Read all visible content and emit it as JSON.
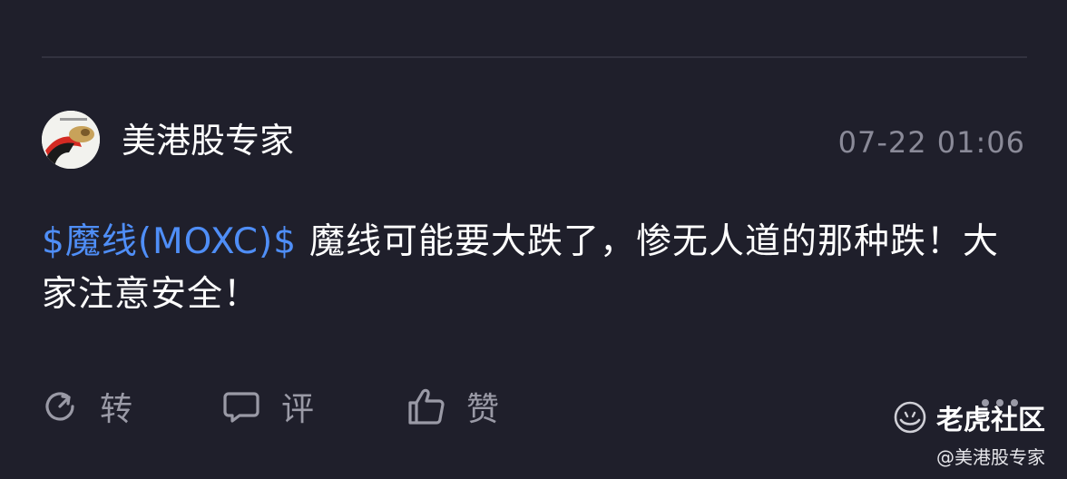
{
  "post": {
    "author": "美港股专家",
    "timestamp": "07-22 01:06",
    "stock_tag": "$魔线(MOXC)$",
    "text": "魔线可能要大跌了，惨无人道的那种跌！大家注意安全！"
  },
  "actions": {
    "repost_label": "转",
    "comment_label": "评",
    "like_label": "赞"
  },
  "watermark": {
    "brand": "老虎社区",
    "credit": "@美港股专家"
  },
  "colors": {
    "background": "#1f1f2b",
    "stock_link": "#4f8ef7",
    "muted": "#9a9aa6"
  }
}
